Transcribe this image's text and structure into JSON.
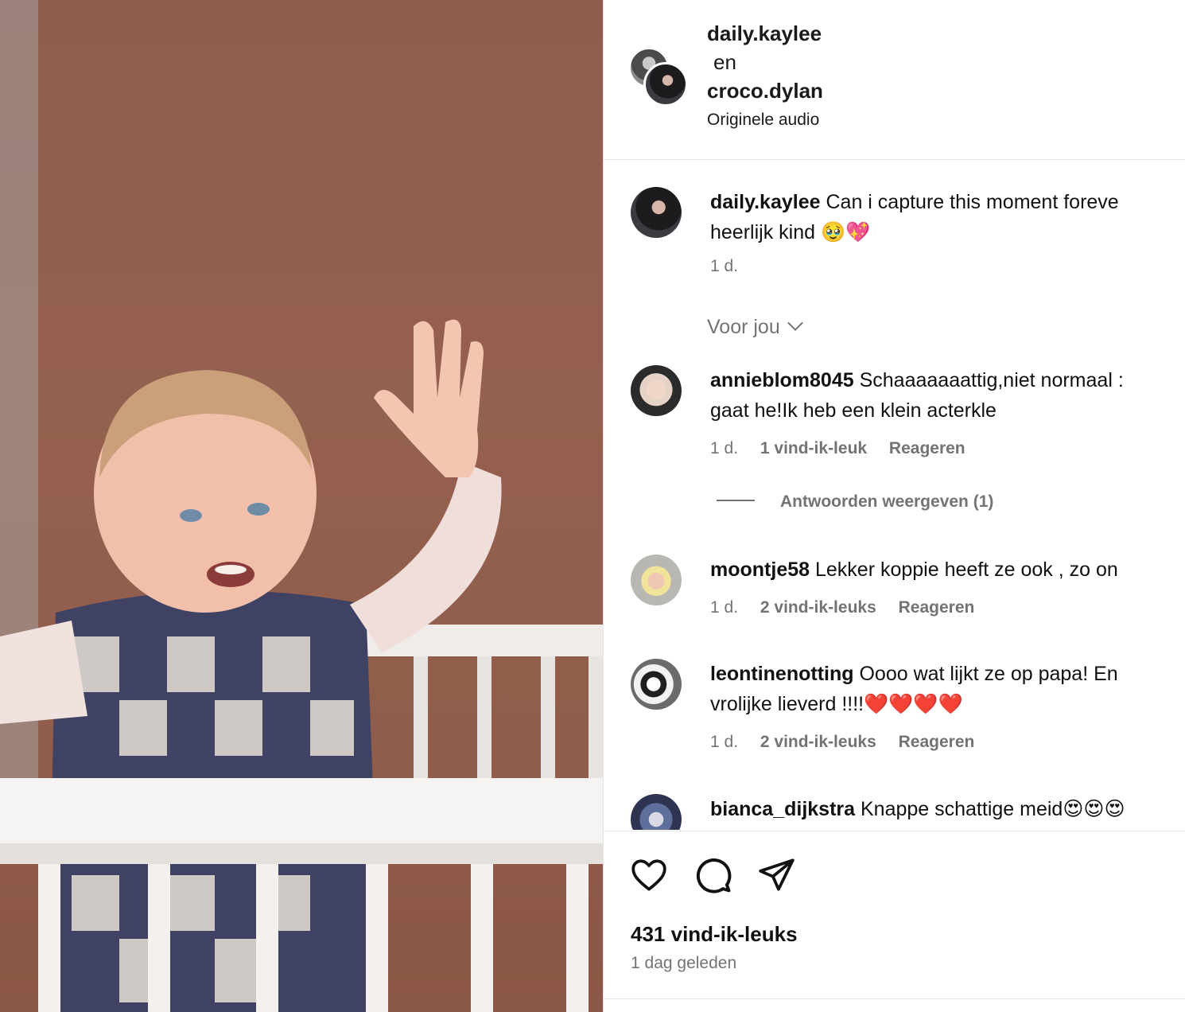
{
  "header": {
    "user1": "daily.kaylee",
    "conjunction": "en",
    "user2": "croco.dylan",
    "audio": "Originele audio"
  },
  "caption": {
    "user": "daily.kaylee",
    "text_line1": "Can i capture this moment foreve",
    "text_line2": "heerlijk kind 🥹💖",
    "time": "1 d."
  },
  "for_you": "Voor jou",
  "comments": [
    {
      "user": "annieblom8045",
      "text_line1": "Schaaaaaaattig,niet normaal :",
      "text_line2": "gaat he!Ik heb een klein acterkle",
      "time": "1 d.",
      "likes": "1 vind-ik-leuk",
      "reply": "Reageren"
    },
    {
      "user": "moontje58",
      "text_line1": "Lekker koppie heeft ze ook , zo on",
      "time": "1 d.",
      "likes": "2 vind-ik-leuks",
      "reply": "Reageren"
    },
    {
      "user": "leontinenotting",
      "text_line1": "Oooo wat lijkt ze op papa! En",
      "text_line2": "vrolijke lieverd !!!!❤️❤️❤️❤️",
      "time": "1 d.",
      "likes": "2 vind-ik-leuks",
      "reply": "Reageren"
    },
    {
      "user": "bianca_dijkstra",
      "text_line1": "Knappe schattige meid😍😍😍"
    }
  ],
  "view_replies": "Antwoorden weergeven (1)",
  "footer": {
    "likes": "431 vind-ik-leuks",
    "date": "1 dag geleden"
  },
  "icons": [
    "heart-icon",
    "comment-icon",
    "share-icon"
  ]
}
